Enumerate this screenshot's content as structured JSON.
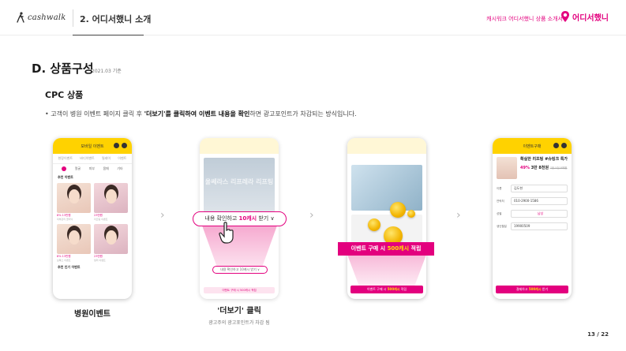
{
  "header": {
    "logo_text": "cashwalk",
    "section": "2. 어디서했니 소개",
    "right_text": "캐시워크 어디서했니 상품 소개서",
    "brand_text": "어디서했니"
  },
  "content": {
    "title": "D. 상품구성",
    "date": "2021.03 기준",
    "subtitle": "CPC 상품",
    "desc_prefix": "• 고객이 병원 이벤트 페이지 클릭 후 ",
    "desc_bold": "'더보기'를 클릭하여 이벤트 내용을 확인",
    "desc_suffix": "하면 광고포인트가 차감되는 방식입니다."
  },
  "phone1": {
    "appbar": "모바일 이벤트",
    "tabs": [
      "현장이벤트",
      "바디이벤트",
      "릴레이",
      "이벤트"
    ],
    "cats": [
      "눈",
      "얼굴",
      "피부",
      "몸매",
      "기타"
    ],
    "section_head": "추천 이벤트",
    "cards": [
      {
        "price": "8% 13만원",
        "meta": "피부관리 클리닉"
      },
      {
        "price": "23만원",
        "meta": "리프팅 이벤트"
      },
      {
        "price": "8% 13만원",
        "meta": "보톡스 이벤트"
      },
      {
        "price": "23만원",
        "meta": "필러 이벤트"
      }
    ],
    "section_head2": "추천 인기 이벤트"
  },
  "phone2": {
    "blur_text": "울쎄라스 리프레라 리프팅",
    "pill_prefix": "내용 확인하고 ",
    "pill_bold": "10캐시",
    "pill_suffix": " 받기 ∨",
    "small_pill": "내용 확인하고 10캐시 받기 ∨",
    "foot": "이벤트 구매 시 500캐시 적립"
  },
  "phone3": {
    "banner_prefix": "이벤트 구매 시 ",
    "banner_bold": "500캐시",
    "banner_suffix": " 적립",
    "foot_prefix": "이벤트 구매 시 ",
    "foot_bold": "500캐시",
    "foot_suffix": " 적립"
  },
  "phone4": {
    "appbar": "이벤트구매",
    "product": "확실한 리프팅 #슈링크 특가",
    "discount": "49%",
    "price": "3만 8천원",
    "orig": "7만 5천 8백원",
    "fields": [
      {
        "label": "이름",
        "value": "김도현"
      },
      {
        "label": "연락처",
        "value": "010-2900-1586"
      },
      {
        "label": "성별",
        "value": "남성"
      },
      {
        "label": "생년월일",
        "value": "19900509"
      }
    ],
    "foot_prefix": "결제하고 ",
    "foot_bold": "500캐시",
    "foot_suffix": " 받기"
  },
  "captions": {
    "c1": "병원이벤트",
    "c2": "'더보기' 클릭",
    "c2_sub": "광고주의 광고포인트가 차감 됨"
  },
  "page_number": "13 / 22",
  "colors": {
    "accent": "#e3007e",
    "yellow": "#ffd200"
  }
}
